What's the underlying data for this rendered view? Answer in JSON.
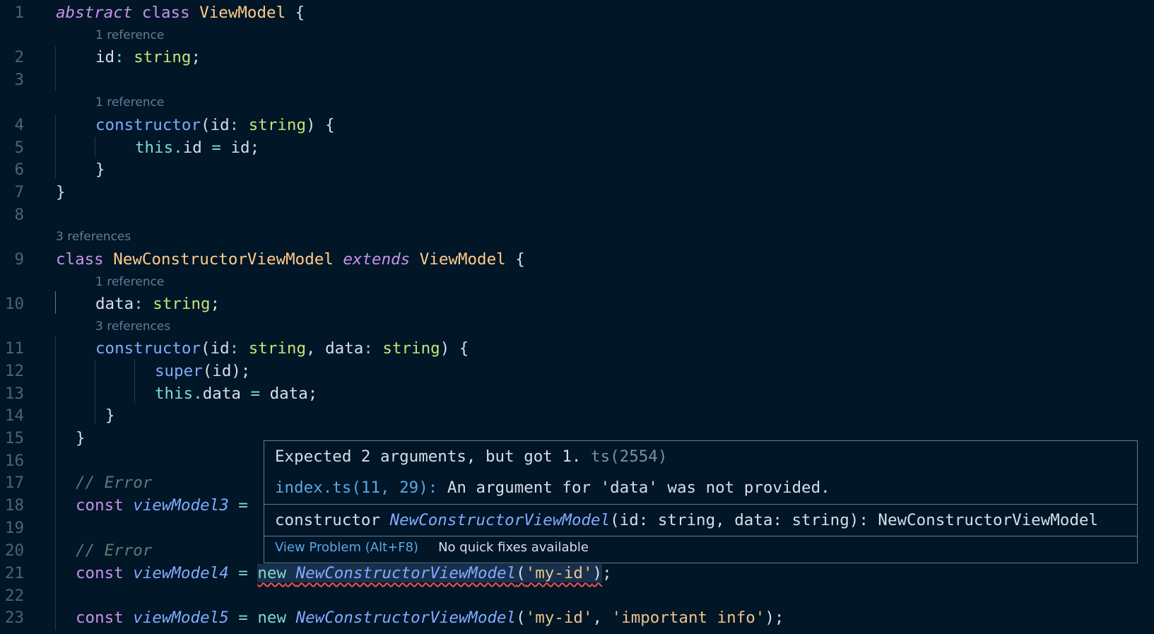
{
  "colors": {
    "background": "#011627",
    "keyword": "#c792ea",
    "class_name": "#ffcb8b",
    "type": "#c5e478",
    "string": "#ecc48d",
    "function": "#82aaff",
    "comment": "#637777",
    "error_underline": "#ef5350",
    "line_number": "#4b6479",
    "code_lens": "#5f7e97"
  },
  "line_numbers": [
    "1",
    "2",
    "3",
    "4",
    "5",
    "6",
    "7",
    "8",
    "9",
    "10",
    "11",
    "12",
    "13",
    "14",
    "15",
    "16",
    "17",
    "18",
    "19",
    "20",
    "21",
    "22",
    "23"
  ],
  "code_lens": {
    "l2": "1 reference",
    "l4": "1 reference",
    "l9": "3 references",
    "l10": "1 reference",
    "l11": "3 references"
  },
  "code": {
    "l1": {
      "abstract": "abstract",
      "class": "class",
      "name": "ViewModel",
      "brace": "{"
    },
    "l2": {
      "prop": "id",
      "colon": ":",
      "type": "string",
      "semi": ";"
    },
    "l4": {
      "ctor": "constructor",
      "open": "(",
      "param": "id",
      "colon": ":",
      "type": "string",
      "close": ")",
      "brace": "{"
    },
    "l5": {
      "this": "this",
      "dot": ".",
      "prop": "id",
      "eq": "=",
      "val": "id",
      "semi": ";"
    },
    "l6": {
      "brace": "}"
    },
    "l7": {
      "brace": "}"
    },
    "l9": {
      "class": "class",
      "name": "NewConstructorViewModel",
      "extends": "extends",
      "parent": "ViewModel",
      "brace": "{"
    },
    "l10": {
      "prop": "data",
      "colon": ":",
      "type": "string",
      "semi": ";"
    },
    "l11": {
      "ctor": "constructor",
      "open": "(",
      "p1": "id",
      "c1": ":",
      "t1": "string",
      "comma": ",",
      "p2": "data",
      "c2": ":",
      "t2": "string",
      "close": ")",
      "brace": "{"
    },
    "l12": {
      "super": "super",
      "args": "(id)",
      "semi": ";"
    },
    "l13": {
      "this": "this",
      "dot": ".",
      "prop": "data",
      "eq": "=",
      "val": "data",
      "semi": ";"
    },
    "l14": {
      "brace": "}"
    },
    "l15": {
      "brace": "}"
    },
    "l17": {
      "comment": "// Error"
    },
    "l18": {
      "const": "const",
      "name": "viewModel3",
      "eq": "="
    },
    "l20": {
      "comment": "// Error"
    },
    "l21": {
      "const": "const",
      "name": "viewModel4",
      "eq": "=",
      "new": "new",
      "ctor": "NewConstructorViewModel",
      "open": "(",
      "arg": "'my-id'",
      "close": ")",
      "semi": ";"
    },
    "l23": {
      "const": "const",
      "name": "viewModel5",
      "eq": "=",
      "new": "new",
      "ctor": "NewConstructorViewModel",
      "open": "(",
      "arg1": "'my-id'",
      "comma": ",",
      "arg2": "'important info'",
      "close": ")",
      "semi": ";"
    }
  },
  "hover": {
    "message": "Expected 2 arguments, but got 1.",
    "code": "ts(2554)",
    "related_location": "index.ts(11, 29):",
    "related_message": "An argument for 'data' was not provided.",
    "signature_kw": "constructor",
    "signature_name": "NewConstructorViewModel",
    "signature_params": "(id: string, data: string): NewConstructorViewModel",
    "view_problem": "View Problem (Alt+F8)",
    "no_fixes": "No quick fixes available"
  }
}
